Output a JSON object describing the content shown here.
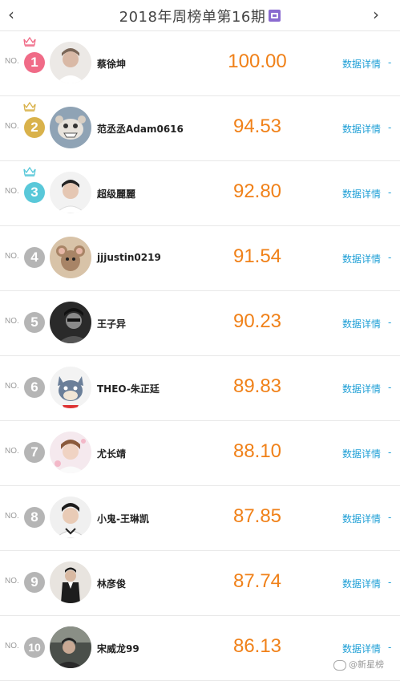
{
  "header": {
    "title": "2018年周榜单第16期",
    "prev_icon": "chevron-left-icon",
    "next_icon": "chevron-right-icon",
    "calendar_icon": "calendar-icon"
  },
  "no_prefix": "NO.",
  "detail_label": "数据详情",
  "detail_arrow": "-",
  "colors": {
    "gold_crown": "#d9b24b",
    "pink_badge": "#f06b87",
    "gold_badge": "#d9b24b",
    "cyan_badge": "#59c8d9",
    "gray_badge": "#b5b5b5",
    "score": "#f08119",
    "link": "#1e9fd6"
  },
  "entries": [
    {
      "rank": "1",
      "name": "蔡徐坤",
      "score": "100.00"
    },
    {
      "rank": "2",
      "name": "范丞丞Adam0616",
      "score": "94.53"
    },
    {
      "rank": "3",
      "name": "超级麗麗",
      "score": "92.80"
    },
    {
      "rank": "4",
      "name": "jjjustin0219",
      "score": "91.54"
    },
    {
      "rank": "5",
      "name": "王子异",
      "score": "90.23"
    },
    {
      "rank": "6",
      "name": "THEO-朱正廷",
      "score": "89.83"
    },
    {
      "rank": "7",
      "name": "尤长靖",
      "score": "88.10"
    },
    {
      "rank": "8",
      "name": "小鬼-王琳凯",
      "score": "87.85"
    },
    {
      "rank": "9",
      "name": "林彦俊",
      "score": "87.74"
    },
    {
      "rank": "10",
      "name": "宋威龙99",
      "score": "86.13"
    }
  ],
  "watermark": "@新星榜"
}
